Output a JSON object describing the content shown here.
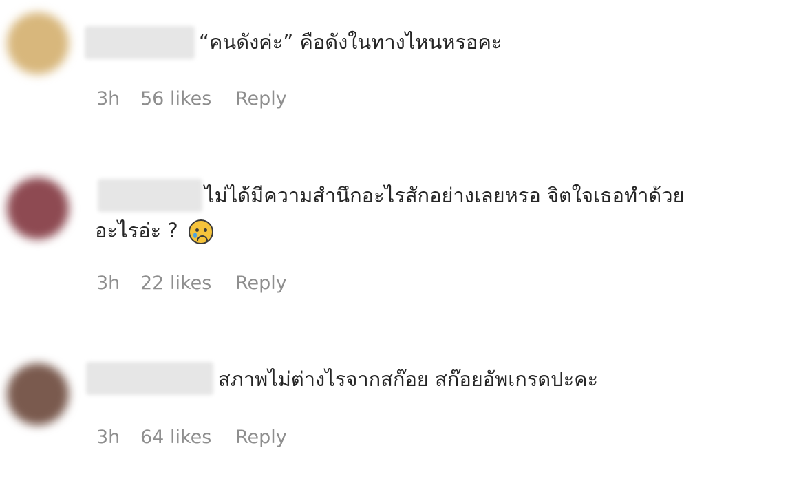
{
  "comments": [
    {
      "text_line1": "“คนดังค่ะ” คือดังในทางไหนหรอคะ",
      "text_line2": "",
      "time": "3h",
      "likes": "56 likes",
      "reply": "Reply",
      "avatar_color": "#d8b77c"
    },
    {
      "text_line1": "ไม่ได้มีความสำนึกอะไรสักอย่างเลยหรอ จิตใจเธอทำด้วย",
      "text_line2": "อะไรอ่ะ ?",
      "emoji": "crying-face-icon",
      "time": "3h",
      "likes": "22 likes",
      "reply": "Reply",
      "avatar_color": "#8e4a52"
    },
    {
      "text_line1": "สภาพไม่ต่างไรจากสก๊อย สก๊อยอัพเกรดปะคะ",
      "text_line2": "",
      "time": "3h",
      "likes": "64 likes",
      "reply": "Reply",
      "avatar_color": "#7a5a4e"
    }
  ]
}
